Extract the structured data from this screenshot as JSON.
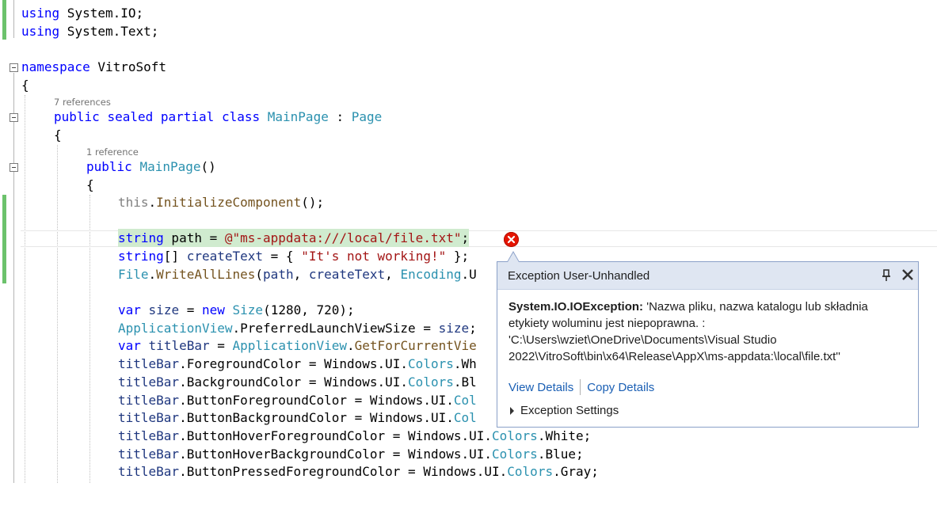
{
  "code": {
    "using_io": [
      "using",
      " System.IO;"
    ],
    "using_text": [
      "using",
      " System.Text;"
    ],
    "namespace_kw": "namespace",
    "namespace_name": " VitroSoft",
    "brace_open": "{",
    "class_refs": "7 references",
    "class_decl": [
      "public",
      " ",
      "sealed",
      " ",
      "partial",
      " ",
      "class",
      " ",
      "MainPage",
      " : ",
      "Page"
    ],
    "ctor_refs": "1 reference",
    "ctor_decl": [
      "public",
      " ",
      "MainPage",
      "()"
    ],
    "init_line": [
      "this",
      ".",
      "InitializeComponent",
      "();"
    ],
    "path_line": [
      "string",
      " path = ",
      "@\"ms-appdata:///local/file.txt\"",
      ";"
    ],
    "createtext_line": [
      "string",
      "[] ",
      "createText",
      " = { ",
      "\"It's not working!\"",
      " };"
    ],
    "write_line": [
      "File",
      ".",
      "WriteAllLines",
      "(",
      "path",
      ", ",
      "createText",
      ", ",
      "Encoding",
      ".U"
    ],
    "size_line": [
      "var",
      " ",
      "size",
      " = ",
      "new",
      " ",
      "Size",
      "(1280, 720);"
    ],
    "appview_line": [
      "ApplicationView",
      ".PreferredLaunchViewSize = ",
      "size",
      ";"
    ],
    "titlebar_line": [
      "var",
      " ",
      "titleBar",
      " = ",
      "ApplicationView",
      ".",
      "GetForCurrentVie"
    ],
    "fg_line": [
      "titleBar",
      ".ForegroundColor = Windows.UI.",
      "Colors",
      ".Wh"
    ],
    "bg_line": [
      "titleBar",
      ".BackgroundColor = Windows.UI.",
      "Colors",
      ".Bl"
    ],
    "btnfg_line": [
      "titleBar",
      ".ButtonForegroundColor = Windows.UI.",
      "Col"
    ],
    "btnbg_line": [
      "titleBar",
      ".ButtonBackgroundColor = Windows.UI.",
      "Col"
    ],
    "hoverfg_line": [
      "titleBar",
      ".ButtonHoverForegroundColor = Windows.UI.",
      "Colors",
      ".White;"
    ],
    "hoverbg_line": [
      "titleBar",
      ".ButtonHoverBackgroundColor = Windows.UI.",
      "Colors",
      ".Blue;"
    ],
    "pressedfg_line": [
      "titleBar",
      ".ButtonPressedForegroundColor = Windows.UI.",
      "Colors",
      ".Gray;"
    ]
  },
  "popup": {
    "title": "Exception User-Unhandled",
    "exception_type": "System.IO.IOException:",
    "message": " 'Nazwa pliku, nazwa katalogu lub składnia etykiety woluminu jest niepoprawna. : 'C:\\Users\\wziet\\OneDrive\\Documents\\Visual Studio 2022\\VitroSoft\\bin\\x64\\Release\\AppX\\ms-appdata:\\local\\file.txt''",
    "view_details": "View Details",
    "copy_details": "Copy Details",
    "exception_settings": "Exception Settings"
  },
  "colors": {
    "keyword": "#0000ff",
    "type": "#2b91af",
    "string": "#a31515",
    "method": "#74531f",
    "error": "#e51400",
    "link": "#1a5fb4"
  },
  "icons": {
    "error": "error-circle-icon",
    "pin": "pin-icon",
    "close": "close-icon"
  }
}
